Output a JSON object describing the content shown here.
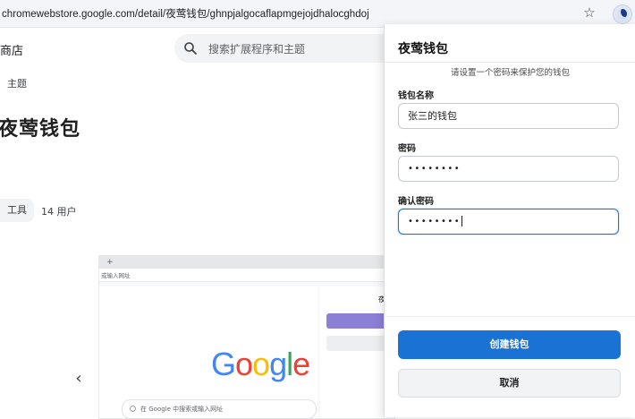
{
  "browser": {
    "url": "chromewebstore.google.com/detail/夜莺钱包/ghnpjalgocaflapmgejojdhalocghdoj",
    "bookmark_icon": "star-icon",
    "extension_icon": "wallet-extension-icon"
  },
  "store": {
    "header_label": "商店",
    "search_placeholder": "搜索扩展程序和主题",
    "breadcrumb": "主题",
    "title": "夜莺钱包",
    "category_chip": "工具",
    "users": "14 用户"
  },
  "preview": {
    "tab_label": "+",
    "address_placeholder": "或输入网址",
    "google_letters": [
      "G",
      "o",
      "o",
      "g",
      "l",
      "e"
    ],
    "search_placeholder": "在 Google 中搜索或输入网址",
    "side_title": "夜"
  },
  "popup": {
    "title": "夜莺钱包",
    "subtitle": "请设置一个密码来保护您的钱包",
    "wallet_name_label": "钱包名称",
    "wallet_name_value": "张三的钱包",
    "password_label": "密码",
    "password_value": "••••••••",
    "confirm_label": "确认密码",
    "confirm_value": "••••••••",
    "create_button": "创建钱包",
    "cancel_button": "取消"
  },
  "colors": {
    "primary": "#1a73d4",
    "focus": "#1a73e8"
  }
}
